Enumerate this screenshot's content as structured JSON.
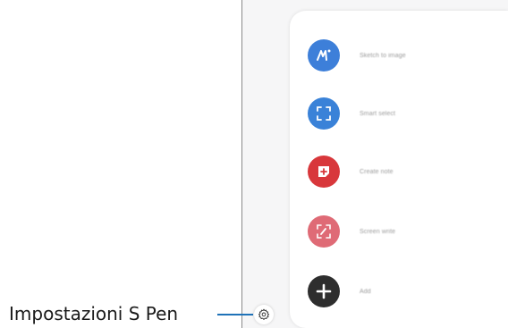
{
  "callout": {
    "label": "Impostazioni S Pen"
  },
  "menu": {
    "items": [
      {
        "name": "sketch-to-image",
        "label": "Sketch to image",
        "color": "#3d7fd9",
        "icon": "sketch-icon"
      },
      {
        "name": "smart-select",
        "label": "Smart select",
        "color": "#3a82d8",
        "icon": "smart-select-icon"
      },
      {
        "name": "create-note",
        "label": "Create note",
        "color": "#d8373b",
        "icon": "create-note-icon"
      },
      {
        "name": "screen-write",
        "label": "Screen write",
        "color": "#df6b76",
        "icon": "screen-write-icon"
      },
      {
        "name": "add",
        "label": "Add",
        "color": "#2e2e2e",
        "icon": "plus-icon"
      }
    ]
  },
  "settings": {
    "icon": "gear-icon",
    "line_color": "#1f72b8"
  }
}
